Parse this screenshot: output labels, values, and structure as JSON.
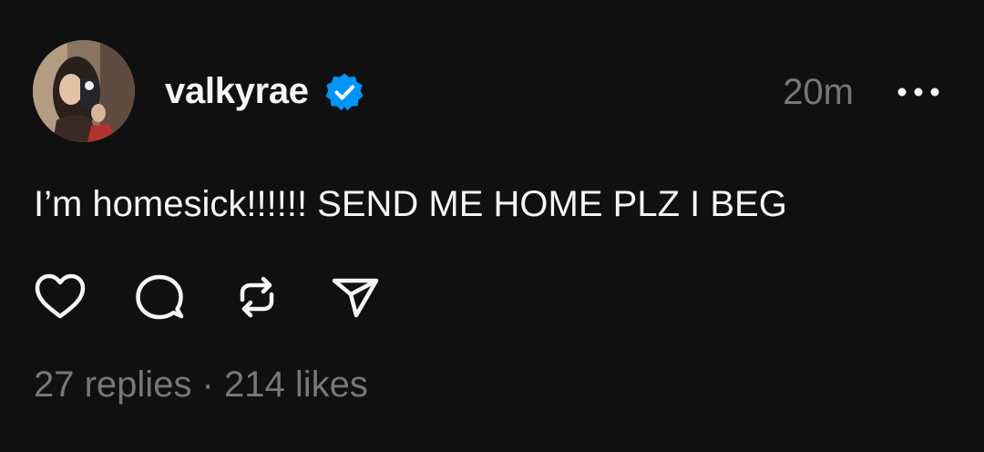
{
  "post": {
    "username": "valkyrae",
    "verified": true,
    "timestamp": "20m",
    "text": "I’m homesick!!!!!! SEND ME HOME PLZ I BEG"
  },
  "stats": {
    "replies": "27 replies",
    "separator": " · ",
    "likes": "214 likes"
  },
  "actions": {
    "icons": [
      "heart-icon",
      "comment-icon",
      "repost-icon",
      "share-icon"
    ]
  },
  "colors": {
    "background": "#101010",
    "primary_text": "#f3f5f7",
    "secondary_text": "#777777",
    "verified_badge": "#0095f6"
  }
}
